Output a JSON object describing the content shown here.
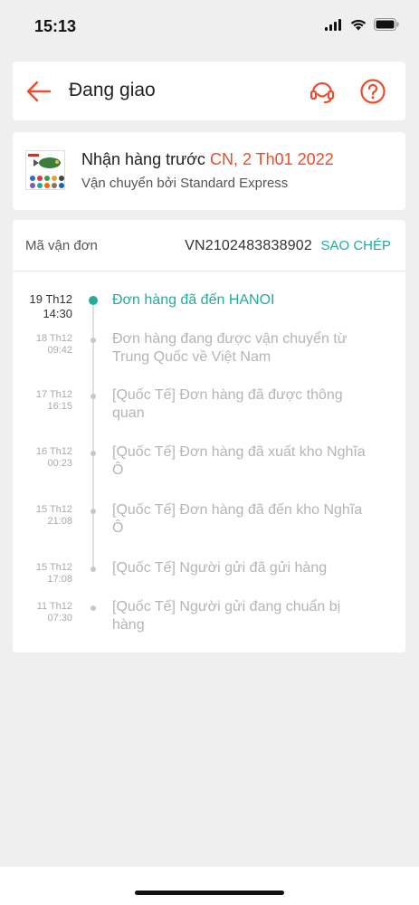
{
  "status_bar": {
    "time": "15:13"
  },
  "header": {
    "title": "Đang giao",
    "accent_color": "#ee4d2d"
  },
  "delivery": {
    "receive_prefix": "Nhận hàng trước",
    "receive_date": "CN, 2 Th01 2022",
    "shipped_by": "Vận chuyển bởi Standard Express"
  },
  "tracking": {
    "code_label": "Mã vận đơn",
    "code": "VN2102483838902",
    "copy_label": "SAO CHÉP",
    "events": [
      {
        "date": "19 Th12",
        "time": "14:30",
        "text": "Đơn hàng đã đến HANOI",
        "active": true
      },
      {
        "date": "18 Th12",
        "time": "09:42",
        "text": "Đơn hàng đang được vận chuyển từ Trung Quốc về Việt Nam",
        "active": false
      },
      {
        "date": "17 Th12",
        "time": "16:15",
        "text": "[Quốc Tế] Đơn hàng đã được thông quan",
        "active": false
      },
      {
        "date": "16 Th12",
        "time": "00:23",
        "text": "[Quốc Tế] Đơn hàng đã xuất kho Nghĩa Ô",
        "active": false
      },
      {
        "date": "15 Th12",
        "time": "21:08",
        "text": "[Quốc Tế] Đơn hàng đã đến kho Nghĩa Ô",
        "active": false
      },
      {
        "date": "15 Th12",
        "time": "17:08",
        "text": "[Quốc Tế] Người gửi đã gửi hàng",
        "active": false
      },
      {
        "date": "11 Th12",
        "time": "07:30",
        "text": "[Quốc Tế] Người gửi đang chuẩn bị hàng",
        "active": false
      }
    ],
    "active_color": "#26aa99"
  }
}
